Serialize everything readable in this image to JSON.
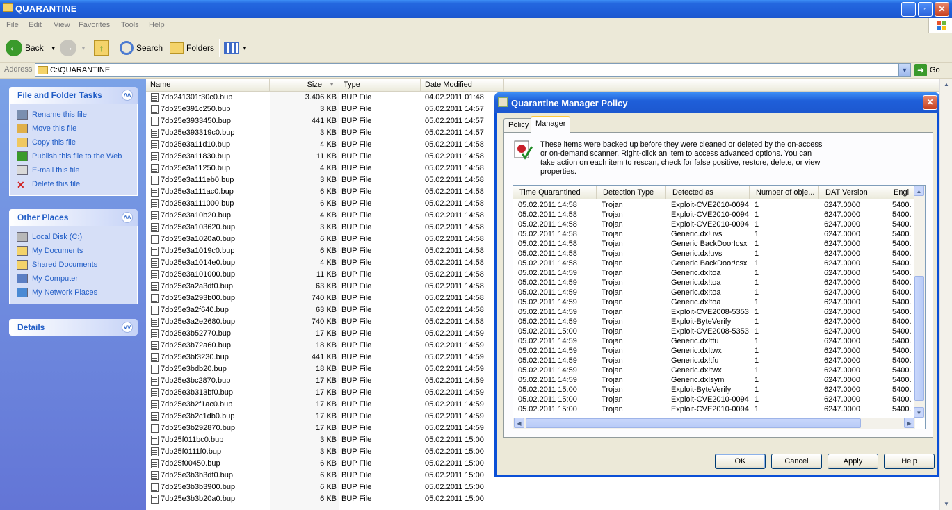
{
  "window": {
    "title": "QUARANTINE",
    "controls": {
      "minimize": "_",
      "restore": "▫",
      "close": "✕"
    }
  },
  "menu": [
    "File",
    "Edit",
    "View",
    "Favorites",
    "Tools",
    "Help"
  ],
  "toolbar": {
    "back": "Back",
    "search": "Search",
    "folders": "Folders"
  },
  "address": {
    "label": "Address",
    "value": "C:\\QUARANTINE",
    "go": "Go"
  },
  "tasks": {
    "file_folder": {
      "title": "File and Folder Tasks",
      "items": [
        {
          "label": "Rename this file",
          "icon": "rename-icon"
        },
        {
          "label": "Move this file",
          "icon": "move-icon"
        },
        {
          "label": "Copy this file",
          "icon": "copy-icon"
        },
        {
          "label": "Publish this file to the Web",
          "icon": "publish-icon"
        },
        {
          "label": "E-mail this file",
          "icon": "email-icon"
        },
        {
          "label": "Delete this file",
          "icon": "delete-icon"
        }
      ]
    },
    "other_places": {
      "title": "Other Places",
      "items": [
        {
          "label": "Local Disk (C:)",
          "icon": "disk-icon"
        },
        {
          "label": "My Documents",
          "icon": "folder-icon"
        },
        {
          "label": "Shared Documents",
          "icon": "folder-icon"
        },
        {
          "label": "My Computer",
          "icon": "computer-icon"
        },
        {
          "label": "My Network Places",
          "icon": "network-icon"
        }
      ]
    },
    "details": {
      "title": "Details"
    }
  },
  "filelist": {
    "columns": [
      "Name",
      "Size",
      "Type",
      "Date Modified"
    ],
    "rows": [
      [
        "7db241301f30c0.bup",
        "3.406 KB",
        "BUP File",
        "04.02.2011 01:48"
      ],
      [
        "7db25e391c250.bup",
        "3 KB",
        "BUP File",
        "05.02.2011 14:57"
      ],
      [
        "7db25e3933450.bup",
        "441 KB",
        "BUP File",
        "05.02.2011 14:57"
      ],
      [
        "7db25e393319c0.bup",
        "3 KB",
        "BUP File",
        "05.02.2011 14:57"
      ],
      [
        "7db25e3a11d10.bup",
        "4 KB",
        "BUP File",
        "05.02.2011 14:58"
      ],
      [
        "7db25e3a11830.bup",
        "11 KB",
        "BUP File",
        "05.02.2011 14:58"
      ],
      [
        "7db25e3a11250.bup",
        "4 KB",
        "BUP File",
        "05.02.2011 14:58"
      ],
      [
        "7db25e3a111eb0.bup",
        "3 KB",
        "BUP File",
        "05.02.2011 14:58"
      ],
      [
        "7db25e3a111ac0.bup",
        "6 KB",
        "BUP File",
        "05.02.2011 14:58"
      ],
      [
        "7db25e3a111000.bup",
        "6 KB",
        "BUP File",
        "05.02.2011 14:58"
      ],
      [
        "7db25e3a10b20.bup",
        "4 KB",
        "BUP File",
        "05.02.2011 14:58"
      ],
      [
        "7db25e3a103620.bup",
        "3 KB",
        "BUP File",
        "05.02.2011 14:58"
      ],
      [
        "7db25e3a1020a0.bup",
        "6 KB",
        "BUP File",
        "05.02.2011 14:58"
      ],
      [
        "7db25e3a1019c0.bup",
        "6 KB",
        "BUP File",
        "05.02.2011 14:58"
      ],
      [
        "7db25e3a1014e0.bup",
        "4 KB",
        "BUP File",
        "05.02.2011 14:58"
      ],
      [
        "7db25e3a101000.bup",
        "11 KB",
        "BUP File",
        "05.02.2011 14:58"
      ],
      [
        "7db25e3a2a3df0.bup",
        "63 KB",
        "BUP File",
        "05.02.2011 14:58"
      ],
      [
        "7db25e3a293b00.bup",
        "740 KB",
        "BUP File",
        "05.02.2011 14:58"
      ],
      [
        "7db25e3a2f640.bup",
        "63 KB",
        "BUP File",
        "05.02.2011 14:58"
      ],
      [
        "7db25e3a2e2680.bup",
        "740 KB",
        "BUP File",
        "05.02.2011 14:58"
      ],
      [
        "7db25e3b52770.bup",
        "17 KB",
        "BUP File",
        "05.02.2011 14:59"
      ],
      [
        "7db25e3b72a60.bup",
        "18 KB",
        "BUP File",
        "05.02.2011 14:59"
      ],
      [
        "7db25e3bf3230.bup",
        "441 KB",
        "BUP File",
        "05.02.2011 14:59"
      ],
      [
        "7db25e3bdb20.bup",
        "18 KB",
        "BUP File",
        "05.02.2011 14:59"
      ],
      [
        "7db25e3bc2870.bup",
        "17 KB",
        "BUP File",
        "05.02.2011 14:59"
      ],
      [
        "7db25e3b313bf0.bup",
        "17 KB",
        "BUP File",
        "05.02.2011 14:59"
      ],
      [
        "7db25e3b2f1ac0.bup",
        "17 KB",
        "BUP File",
        "05.02.2011 14:59"
      ],
      [
        "7db25e3b2c1db0.bup",
        "17 KB",
        "BUP File",
        "05.02.2011 14:59"
      ],
      [
        "7db25e3b292870.bup",
        "17 KB",
        "BUP File",
        "05.02.2011 14:59"
      ],
      [
        "7db25f011bc0.bup",
        "3 KB",
        "BUP File",
        "05.02.2011 15:00"
      ],
      [
        "7db25f0111f0.bup",
        "3 KB",
        "BUP File",
        "05.02.2011 15:00"
      ],
      [
        "7db25f00450.bup",
        "6 KB",
        "BUP File",
        "05.02.2011 15:00"
      ],
      [
        "7db25e3b3b3df0.bup",
        "6 KB",
        "BUP File",
        "05.02.2011 15:00"
      ],
      [
        "7db25e3b3b3900.bup",
        "6 KB",
        "BUP File",
        "05.02.2011 15:00"
      ],
      [
        "7db25e3b3b20a0.bup",
        "6 KB",
        "BUP File",
        "05.02.2011 15:00"
      ]
    ]
  },
  "dialog": {
    "title": "Quarantine Manager Policy",
    "tabs": [
      "Policy",
      "Manager"
    ],
    "active_tab": "Manager",
    "info": "These items were backed up before they were cleaned or deleted by the on-access or on-demand scanner. Right-click an item to access advanced options. You can take action on each item to rescan, check for false positive, restore, delete, or view properties.",
    "columns": [
      "Time Quarantined",
      "Detection Type",
      "Detected as",
      "Number of obje...",
      "DAT Version",
      "Engi"
    ],
    "rows": [
      [
        "05.02.2011 14:58",
        "Trojan",
        "Exploit-CVE2010-0094",
        "1",
        "6247.0000",
        "5400."
      ],
      [
        "05.02.2011 14:58",
        "Trojan",
        "Exploit-CVE2010-0094",
        "1",
        "6247.0000",
        "5400."
      ],
      [
        "05.02.2011 14:58",
        "Trojan",
        "Exploit-CVE2010-0094",
        "1",
        "6247.0000",
        "5400."
      ],
      [
        "05.02.2011 14:58",
        "Trojan",
        "Generic.dx!uvs",
        "1",
        "6247.0000",
        "5400."
      ],
      [
        "05.02.2011 14:58",
        "Trojan",
        "Generic BackDoor!csx",
        "1",
        "6247.0000",
        "5400."
      ],
      [
        "05.02.2011 14:58",
        "Trojan",
        "Generic.dx!uvs",
        "1",
        "6247.0000",
        "5400."
      ],
      [
        "05.02.2011 14:58",
        "Trojan",
        "Generic BackDoor!csx",
        "1",
        "6247.0000",
        "5400."
      ],
      [
        "05.02.2011 14:59",
        "Trojan",
        "Generic.dx!toa",
        "1",
        "6247.0000",
        "5400."
      ],
      [
        "05.02.2011 14:59",
        "Trojan",
        "Generic.dx!toa",
        "1",
        "6247.0000",
        "5400."
      ],
      [
        "05.02.2011 14:59",
        "Trojan",
        "Generic.dx!toa",
        "1",
        "6247.0000",
        "5400."
      ],
      [
        "05.02.2011 14:59",
        "Trojan",
        "Generic.dx!toa",
        "1",
        "6247.0000",
        "5400."
      ],
      [
        "05.02.2011 14:59",
        "Trojan",
        "Exploit-CVE2008-5353",
        "1",
        "6247.0000",
        "5400."
      ],
      [
        "05.02.2011 14:59",
        "Trojan",
        "Exploit-ByteVerify",
        "1",
        "6247.0000",
        "5400."
      ],
      [
        "05.02.2011 15:00",
        "Trojan",
        "Exploit-CVE2008-5353",
        "1",
        "6247.0000",
        "5400."
      ],
      [
        "05.02.2011 14:59",
        "Trojan",
        "Generic.dx!tfu",
        "1",
        "6247.0000",
        "5400."
      ],
      [
        "05.02.2011 14:59",
        "Trojan",
        "Generic.dx!twx",
        "1",
        "6247.0000",
        "5400."
      ],
      [
        "05.02.2011 14:59",
        "Trojan",
        "Generic.dx!tfu",
        "1",
        "6247.0000",
        "5400."
      ],
      [
        "05.02.2011 14:59",
        "Trojan",
        "Generic.dx!twx",
        "1",
        "6247.0000",
        "5400."
      ],
      [
        "05.02.2011 14:59",
        "Trojan",
        "Generic.dx!sym",
        "1",
        "6247.0000",
        "5400."
      ],
      [
        "05.02.2011 15:00",
        "Trojan",
        "Exploit-ByteVerify",
        "1",
        "6247.0000",
        "5400."
      ],
      [
        "05.02.2011 15:00",
        "Trojan",
        "Exploit-CVE2010-0094",
        "1",
        "6247.0000",
        "5400."
      ],
      [
        "05.02.2011 15:00",
        "Trojan",
        "Exploit-CVE2010-0094",
        "1",
        "6247.0000",
        "5400."
      ]
    ],
    "buttons": {
      "ok": "OK",
      "cancel": "Cancel",
      "apply": "Apply",
      "help": "Help"
    }
  },
  "colors": {
    "xp_blue": "#0a4fd6",
    "task_link": "#215dc6",
    "pane_top": "#7ba2e7"
  }
}
